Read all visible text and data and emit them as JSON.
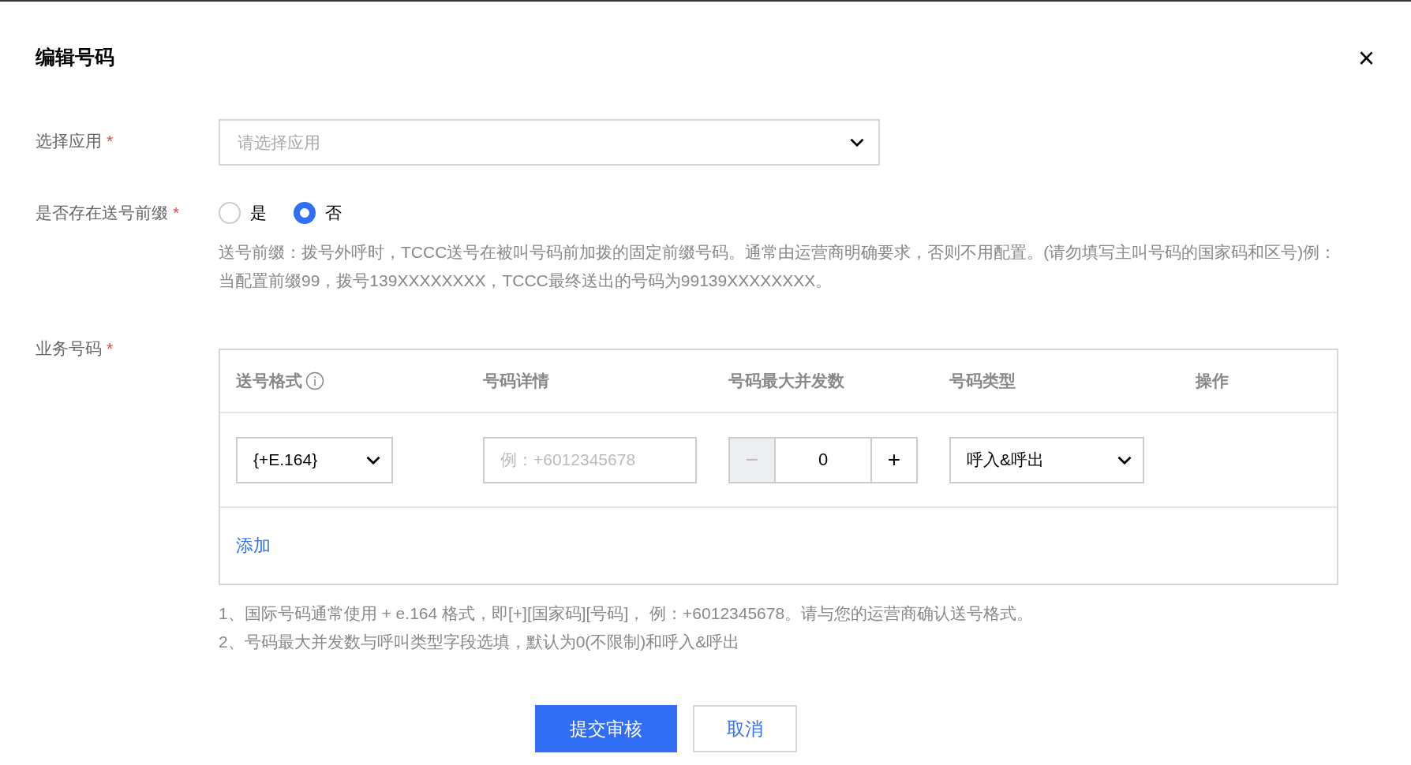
{
  "dialog": {
    "title": "编辑号码",
    "close": "×"
  },
  "app_field": {
    "label": "选择应用",
    "required_mark": "*",
    "placeholder": "请选择应用"
  },
  "prefix_field": {
    "label": "是否存在送号前缀",
    "required_mark": "*",
    "options": [
      {
        "label": "是",
        "selected": false
      },
      {
        "label": "否",
        "selected": true
      }
    ],
    "help": "送号前缀：拨号外呼时，TCCC送号在被叫号码前加拨的固定前缀号码。通常由运营商明确要求，否则不用配置。(请勿填写主叫号码的国家码和区号)例：当配置前缀99，拨号139XXXXXXXX，TCCC最终送出的号码为99139XXXXXXXX。"
  },
  "numbers_field": {
    "label": "业务号码",
    "required_mark": "*",
    "table": {
      "columns": [
        {
          "label": "送号格式",
          "info": true
        },
        {
          "label": "号码详情",
          "info": false
        },
        {
          "label": "号码最大并发数",
          "info": false
        },
        {
          "label": "号码类型",
          "info": false
        },
        {
          "label": "操作",
          "info": false
        }
      ],
      "rows": [
        {
          "format": "{+E.164}",
          "detail_placeholder": "例：+6012345678",
          "minus": "−",
          "concurrency": "0",
          "plus": "+",
          "minus_disabled": true,
          "type": "呼入&呼出"
        }
      ],
      "add_link": "添加"
    },
    "notes": [
      "1、国际号码通常使用 + e.164 格式，即[+][国家码][号码]， 例：+6012345678。请与您的运营商确认送号格式。",
      "2、号码最大并发数与呼叫类型字段选填，默认为0(不限制)和呼入&呼出"
    ]
  },
  "buttons": [
    {
      "label": "提交审核",
      "kind": "primary"
    },
    {
      "label": "取消",
      "kind": "secondary"
    }
  ]
}
